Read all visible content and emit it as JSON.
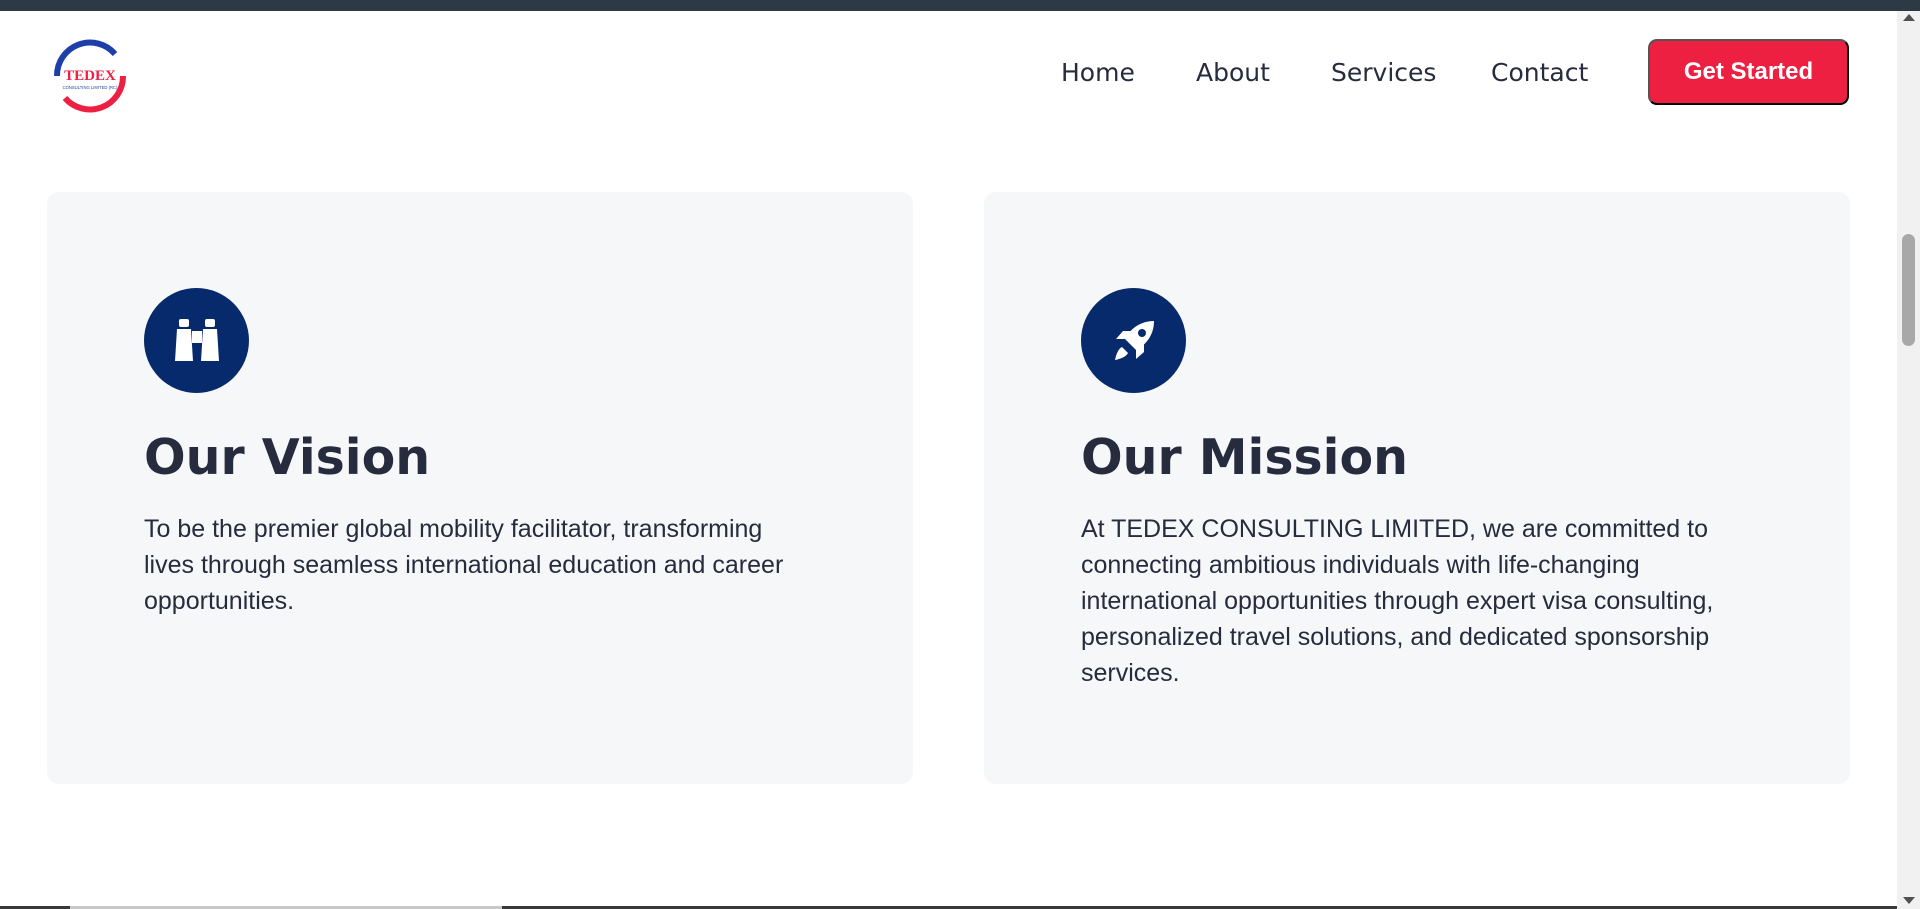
{
  "brand": {
    "logo_text": "TEDEX",
    "logo_subtext": "CONSULTING LIMITED (RC)",
    "colors": {
      "red": "#ee2042",
      "blue": "#1f3fa8",
      "navy": "#062a6b"
    }
  },
  "nav": {
    "items": [
      {
        "label": "Home"
      },
      {
        "label": "About"
      },
      {
        "label": "Services"
      },
      {
        "label": "Contact"
      }
    ],
    "cta_label": "Get Started"
  },
  "cards": {
    "vision": {
      "icon": "binoculars-icon",
      "title": "Our Vision",
      "text": "To be the premier global mobility facilitator, transforming lives through seamless international education and career opportunities."
    },
    "mission": {
      "icon": "rocket-icon",
      "title": "Our Mission",
      "text": "At TEDEX CONSULTING LIMITED, we are committed to connecting ambitious individuals with life-changing international opportunities through expert visa consulting, personalized travel solutions, and dedicated sponsorship services."
    }
  }
}
